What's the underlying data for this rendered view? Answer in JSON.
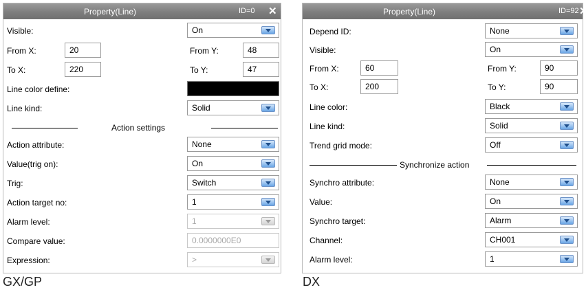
{
  "left": {
    "title": "Property(Line)",
    "id_label": "ID=0",
    "close_glyph": "✕",
    "visible": {
      "label": "Visible:",
      "value": "On"
    },
    "from_x": {
      "label": "From X:",
      "value": "20"
    },
    "from_y": {
      "label": "From Y:",
      "value": "48"
    },
    "to_x": {
      "label": "To X:",
      "value": "220"
    },
    "to_y": {
      "label": "To Y:",
      "value": "47"
    },
    "line_color_define": {
      "label": "Line color define:",
      "color": "#000000"
    },
    "line_kind": {
      "label": "Line kind:",
      "value": "Solid"
    },
    "section_title": "Action settings",
    "action_attribute": {
      "label": "Action attribute:",
      "value": "None"
    },
    "value_trig_on": {
      "label": "Value(trig on):",
      "value": "On"
    },
    "trig": {
      "label": "Trig:",
      "value": "Switch"
    },
    "action_target_no": {
      "label": "Action target no:",
      "value": "1"
    },
    "alarm_level": {
      "label": "Alarm level:",
      "value": "1"
    },
    "compare_value": {
      "label": "Compare value:",
      "value": "0.0000000E0"
    },
    "expression": {
      "label": "Expression:",
      "value": ">"
    }
  },
  "right": {
    "title": "Property(Line)",
    "id_label": "ID=92",
    "close_glyph": "✕",
    "depend_id": {
      "label": "Depend ID:",
      "value": "None"
    },
    "visible": {
      "label": "Visible:",
      "value": "On"
    },
    "from_x": {
      "label": "From X:",
      "value": "60"
    },
    "from_y": {
      "label": "From Y:",
      "value": "90"
    },
    "to_x": {
      "label": "To X:",
      "value": "200"
    },
    "to_y": {
      "label": "To Y:",
      "value": "90"
    },
    "line_color": {
      "label": "Line color:",
      "value": "Black"
    },
    "line_kind": {
      "label": "Line kind:",
      "value": "Solid"
    },
    "trend_grid_mode": {
      "label": "Trend grid mode:",
      "value": "Off"
    },
    "section_title": "Synchronize action",
    "synchro_attribute": {
      "label": "Synchro attribute:",
      "value": "None"
    },
    "value": {
      "label": "Value:",
      "value": "On"
    },
    "synchro_target": {
      "label": "Synchro target:",
      "value": "Alarm"
    },
    "channel": {
      "label": "Channel:",
      "value": "CH001"
    },
    "alarm_level": {
      "label": "Alarm level:",
      "value": "1"
    }
  },
  "captions": {
    "left": "GX/GP",
    "right": "DX"
  },
  "colors": {
    "titlebar": "#7e7e7e",
    "dropdown_arrow": "#6aa6e6",
    "disabled_text": "#a8a8a8",
    "line_color_swatch": "#000000"
  }
}
